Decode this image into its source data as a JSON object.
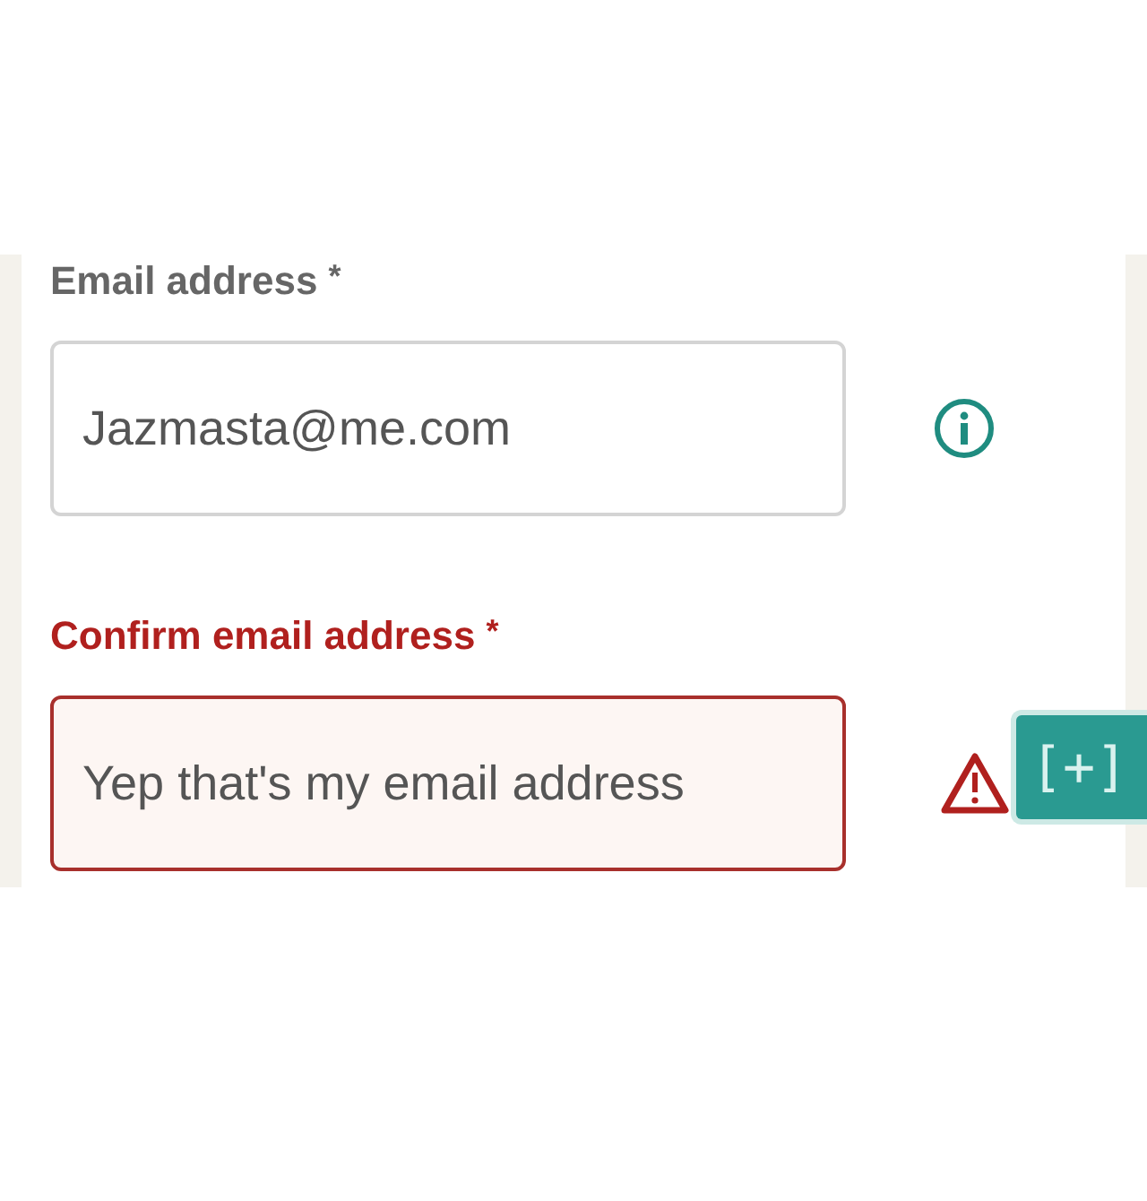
{
  "fields": [
    {
      "label": "Email address",
      "required_mark": "*",
      "value": "Jazmasta@me.com",
      "error": false,
      "kind": "info"
    },
    {
      "label": "Confirm email address",
      "required_mark": "*",
      "value": "Yep that's my email address",
      "error": true,
      "kind": "warning"
    }
  ],
  "side_button": {
    "label": "[+]"
  }
}
